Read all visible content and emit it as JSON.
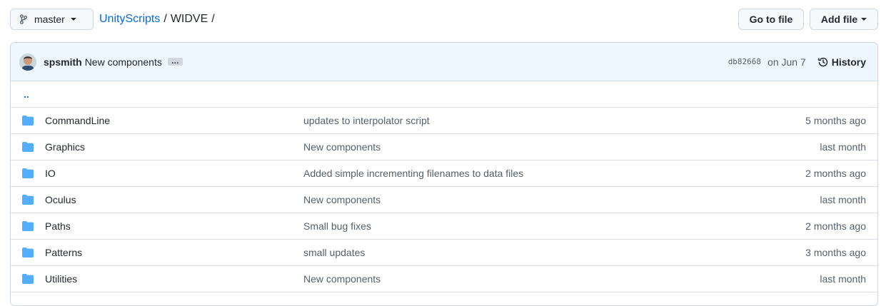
{
  "toolbar": {
    "branch": "master",
    "breadcrumb": {
      "repo": "UnityScripts",
      "sep1": "/",
      "folder": "WIDVE",
      "sep2": "/"
    },
    "goto_file": "Go to file",
    "add_file": "Add file"
  },
  "commit": {
    "author": "spsmith",
    "message": "New components",
    "ellipsis": "…",
    "sha": "db82668",
    "date": "on Jun 7",
    "history": "History"
  },
  "files": {
    "updir": "..",
    "rows": [
      {
        "name": "CommandLine",
        "message": "updates to interpolator script",
        "age": "5 months ago"
      },
      {
        "name": "Graphics",
        "message": "New components",
        "age": "last month"
      },
      {
        "name": "IO",
        "message": "Added simple incrementing filenames to data files",
        "age": "2 months ago"
      },
      {
        "name": "Oculus",
        "message": "New components",
        "age": "last month"
      },
      {
        "name": "Paths",
        "message": "Small bug fixes",
        "age": "2 months ago"
      },
      {
        "name": "Patterns",
        "message": "small updates",
        "age": "3 months ago"
      },
      {
        "name": "Utilities",
        "message": "New components",
        "age": "last month"
      }
    ]
  },
  "colors": {
    "accent": "#0969da",
    "folder": "#54aeff",
    "commit_bg": "#eef6ff"
  }
}
